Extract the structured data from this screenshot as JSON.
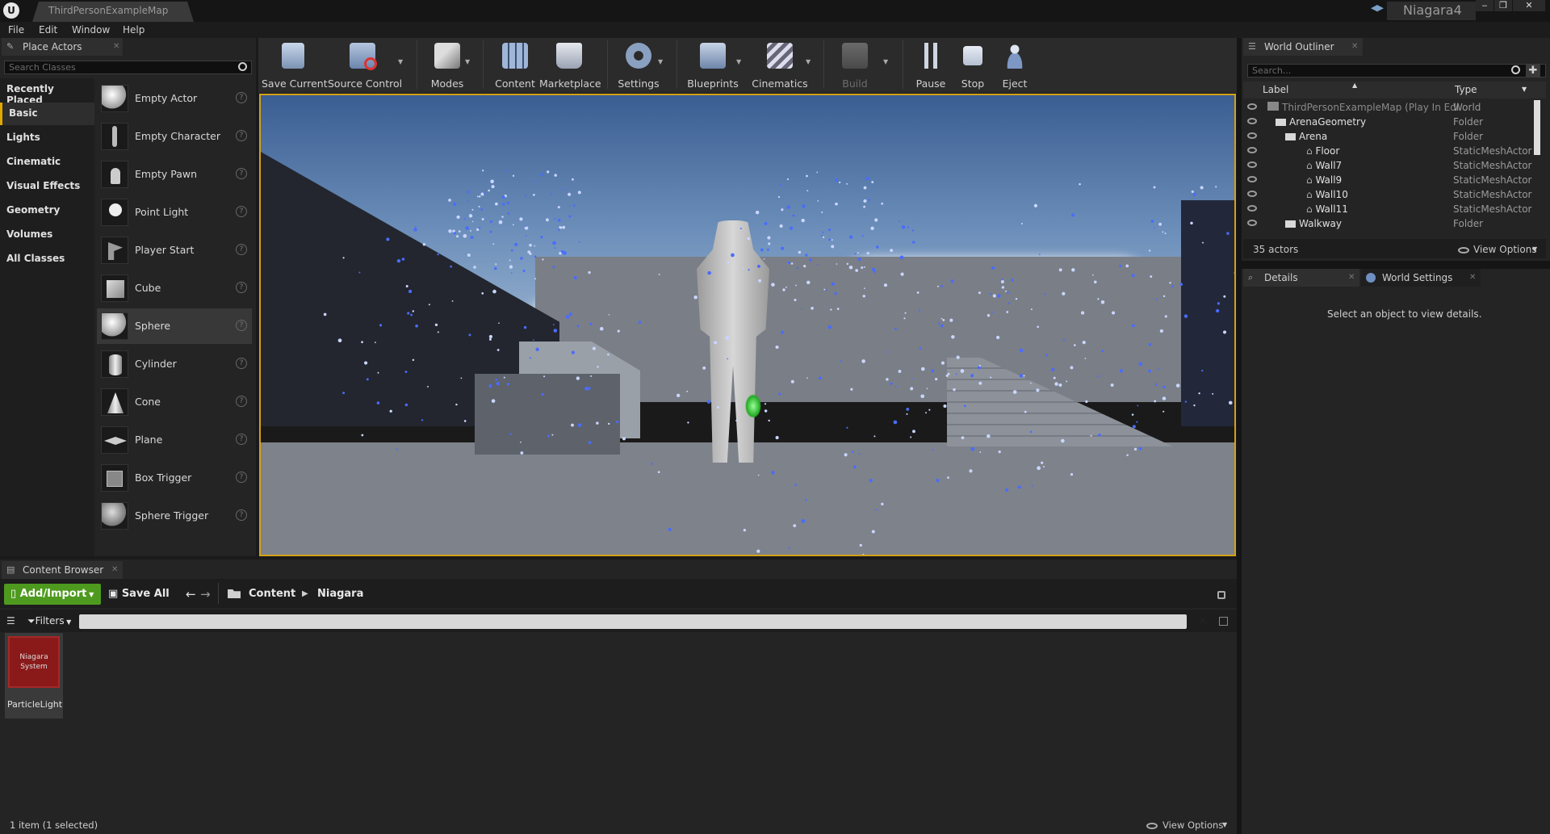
{
  "window": {
    "doc_tab": "ThirdPersonExampleMap",
    "project_name": "Niagara4",
    "buttons": [
      "‒",
      "❐",
      "✕"
    ]
  },
  "menu": [
    "File",
    "Edit",
    "Window",
    "Help"
  ],
  "place_actors": {
    "tab_title": "Place Actors",
    "search_placeholder": "Search Classes",
    "categories": [
      "Recently Placed",
      "Basic",
      "Lights",
      "Cinematic",
      "Visual Effects",
      "Geometry",
      "Volumes",
      "All Classes"
    ],
    "active_category": "Basic",
    "items": [
      "Empty Actor",
      "Empty Character",
      "Empty Pawn",
      "Point Light",
      "Player Start",
      "Cube",
      "Sphere",
      "Cylinder",
      "Cone",
      "Plane",
      "Box Trigger",
      "Sphere Trigger"
    ],
    "selected_item": "Sphere"
  },
  "toolbar": {
    "tools": [
      "Save Current",
      "Source Control",
      "Modes",
      "Content",
      "Marketplace",
      "Settings",
      "Blueprints",
      "Cinematics",
      "Build",
      "Pause",
      "Stop",
      "Eject"
    ],
    "disabled": [
      "Build"
    ]
  },
  "world_outliner": {
    "tab_title": "World Outliner",
    "search_placeholder": "Search...",
    "col_label": "Label",
    "col_type": "Type",
    "rows": [
      {
        "label": "ThirdPersonExampleMap (Play In Edi",
        "type": "World"
      },
      {
        "label": "ArenaGeometry",
        "type": "Folder"
      },
      {
        "label": "Arena",
        "type": "Folder"
      },
      {
        "label": "Floor",
        "type": "StaticMeshActor"
      },
      {
        "label": "Wall7",
        "type": "StaticMeshActor"
      },
      {
        "label": "Wall9",
        "type": "StaticMeshActor"
      },
      {
        "label": "Wall10",
        "type": "StaticMeshActor"
      },
      {
        "label": "Wall11",
        "type": "StaticMeshActor"
      },
      {
        "label": "Walkway",
        "type": "Folder"
      }
    ],
    "actor_count": "35 actors",
    "view_options": "View Options"
  },
  "details": {
    "tab_details": "Details",
    "tab_world_settings": "World Settings",
    "empty_message": "Select an object to view details."
  },
  "content_browser": {
    "tab_title": "Content Browser",
    "add_import": "Add/Import",
    "save_all": "Save All",
    "path": [
      "Content",
      "Niagara"
    ],
    "filters": "Filters",
    "asset_thumb": "Niagara System",
    "asset_name": "ParticleLight",
    "status": "1 item (1 selected)",
    "view_options": "View Options"
  },
  "colors": {
    "accent_gold": "#d4a017",
    "add_import_green": "#4e9a1f",
    "particle_blue": "#4a6cff"
  }
}
